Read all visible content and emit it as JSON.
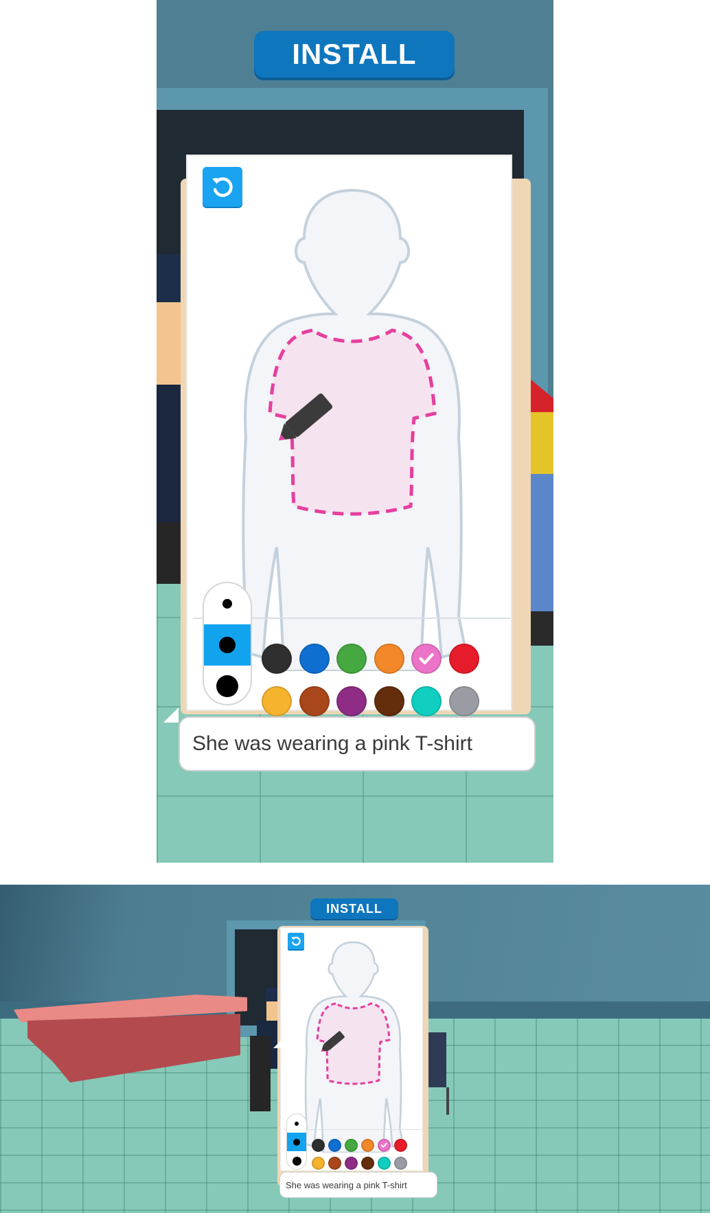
{
  "install_button": {
    "label": "INSTALL"
  },
  "caption": {
    "text": "She was wearing a pink T-shirt"
  },
  "colors": {
    "row1": [
      "#2f2f2f",
      "#0f6fd1",
      "#45a840",
      "#f2882a",
      "#ec74c8",
      "#e71c2a"
    ],
    "row2": [
      "#f5b32e",
      "#a9471b",
      "#8e2c86",
      "#642d0c",
      "#10cfc0",
      "#9a9ca3"
    ],
    "selected": "#ec74c8",
    "accent": "#12a3ef",
    "outfit_dash": "#e53f9e",
    "outfit_fill": "#f6e3f0"
  },
  "brush_sizes": [
    "small",
    "medium",
    "large"
  ],
  "selected_brush": "medium",
  "icons": {
    "undo": "undo-icon",
    "check": "check-icon",
    "pencil": "pencil-icon"
  }
}
